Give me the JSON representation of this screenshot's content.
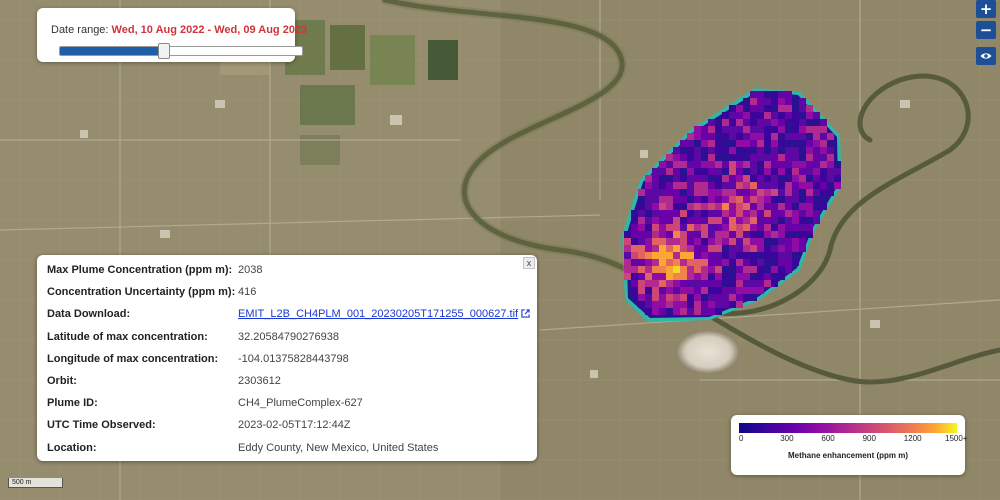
{
  "date_range": {
    "label": "Date range:",
    "value": "Wed, 10 Aug 2022 - Wed, 09 Aug 2023",
    "slider_fraction": 0.43
  },
  "map_controls": {
    "zoom_in": "+",
    "zoom_out": "−",
    "layers_icon": "eye-icon"
  },
  "info_popup": {
    "close_label": "x",
    "rows": [
      {
        "key": "Max Plume Concentration (ppm m):",
        "value": "2038"
      },
      {
        "key": "Concentration Uncertainty (ppm m):",
        "value": "416"
      },
      {
        "key": "Data Download:",
        "value": "EMIT_L2B_CH4PLM_001_20230205T171255_000627.tif",
        "link": true
      },
      {
        "key": "Latitude of max concentration:",
        "value": "32.20584790276938"
      },
      {
        "key": "Longitude of max concentration:",
        "value": "-104.01375828443798"
      },
      {
        "key": "Orbit:",
        "value": "2303612"
      },
      {
        "key": "Plume ID:",
        "value": "CH4_PlumeComplex-627"
      },
      {
        "key": "UTC Time Observed:",
        "value": "2023-02-05T17:12:44Z"
      },
      {
        "key": "Location:",
        "value": "Eddy County, New Mexico, United States"
      }
    ]
  },
  "legend": {
    "ticks": [
      "0",
      "300",
      "600",
      "900",
      "1200",
      "1500+"
    ],
    "title": "Methane enhancement (ppm m)"
  },
  "scale_bar": "500 m",
  "colors": {
    "accent": "#1c4f95",
    "date_text": "#d0343a",
    "link": "#1a38d6",
    "plume_outline": "#2fb8a8"
  }
}
